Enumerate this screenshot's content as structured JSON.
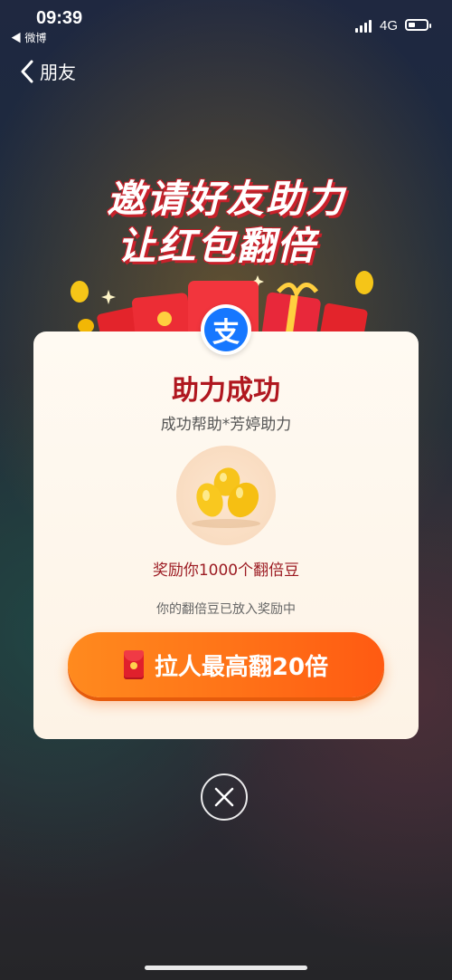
{
  "status_bar": {
    "time": "09:39",
    "back_app": "◀ 微博",
    "network": "4G"
  },
  "nav": {
    "back_label": "朋友"
  },
  "headline": {
    "line1": "邀请好友助力",
    "line2": "让红包翻倍"
  },
  "card": {
    "badge_glyph": "支",
    "title": "助力成功",
    "subtitle": "成功帮助*芳婷助力",
    "reward": "奖励你1000个翻倍豆",
    "note": "你的翻倍豆已放入奖励中",
    "cta_label": "拉人最高翻20倍"
  },
  "colors": {
    "accent_red": "#b0171f",
    "cta_orange": "#ff7418",
    "alipay_blue": "#1677ff"
  },
  "icons": {
    "back": "chevron-left-icon",
    "close": "close-icon",
    "cta": "red-envelope-icon",
    "bean": "gold-beans-icon"
  }
}
